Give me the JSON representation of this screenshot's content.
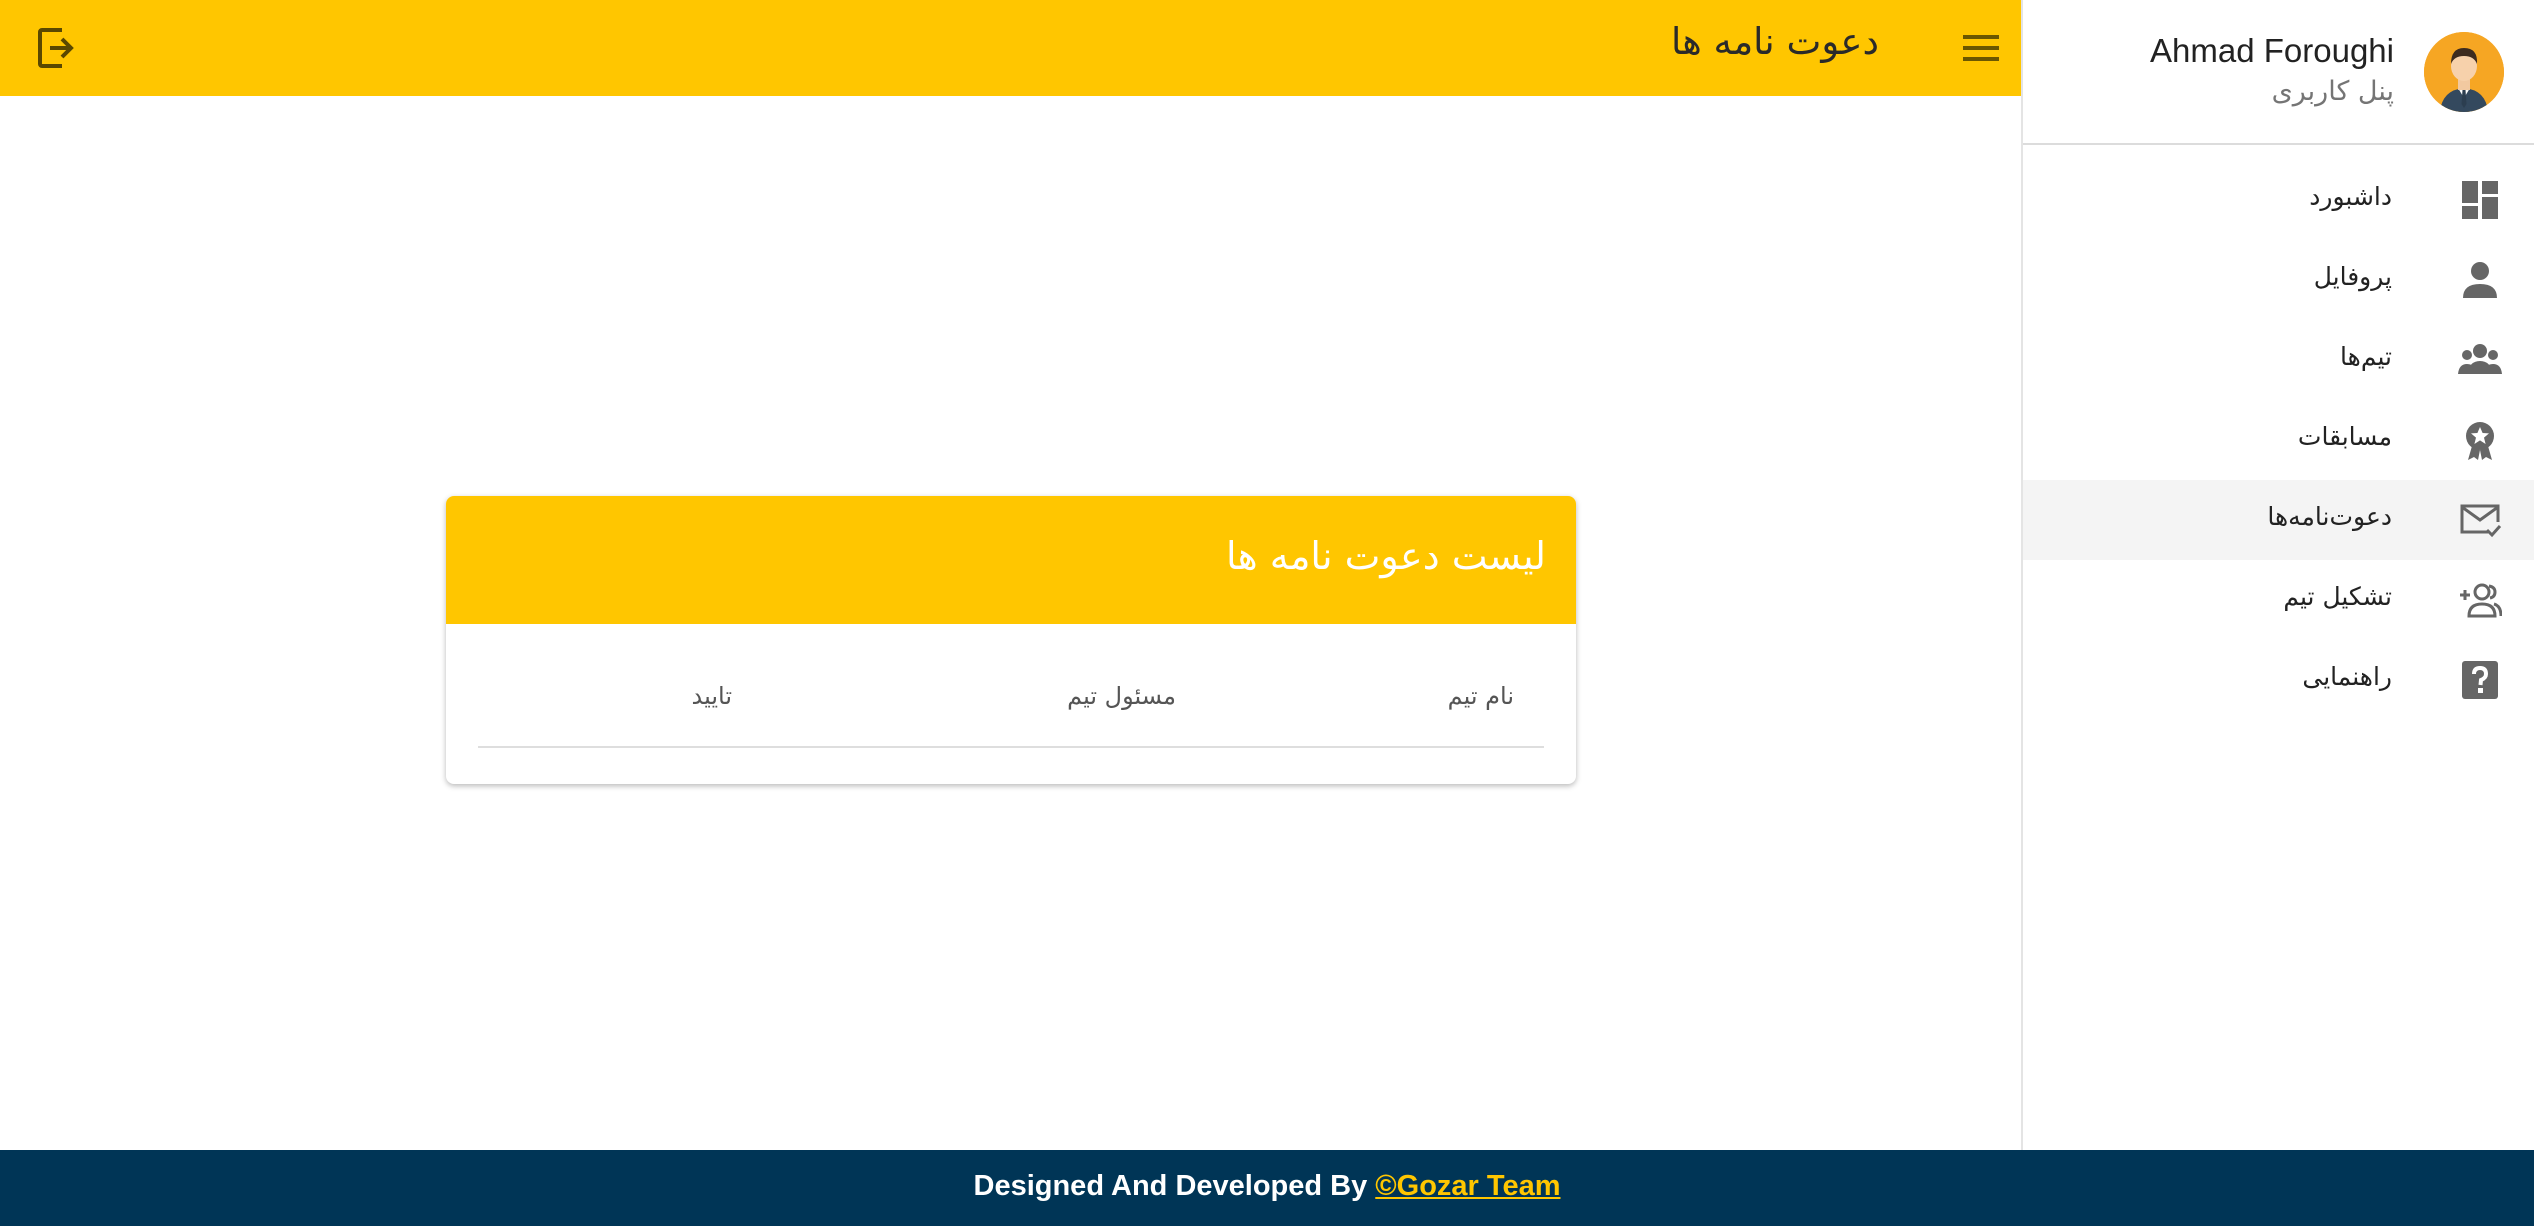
{
  "header": {
    "title": "دعوت نامه ها",
    "menu_icon": "hamburger-menu-icon",
    "logout_icon": "logout-icon"
  },
  "sidebar": {
    "user": {
      "name": "Ahmad Foroughi",
      "role": "پنل کاربری",
      "avatar_icon": "user-avatar-icon"
    },
    "items": [
      {
        "label": "داشبورد",
        "icon": "dashboard-icon",
        "active": false
      },
      {
        "label": "پروفایل",
        "icon": "person-icon",
        "active": false
      },
      {
        "label": "تیم‌ها",
        "icon": "group-icon",
        "active": false
      },
      {
        "label": "مسابقات",
        "icon": "award-icon",
        "active": false
      },
      {
        "label": "دعوت‌نامه‌ها",
        "icon": "mail-check-icon",
        "active": true
      },
      {
        "label": "تشکیل تیم",
        "icon": "group-add-icon",
        "active": false
      },
      {
        "label": "راهنمایی",
        "icon": "help-icon",
        "active": false
      }
    ]
  },
  "card": {
    "title": "لیست دعوت نامه ها",
    "columns": [
      "نام تیم",
      "مسئول تیم",
      "تایید"
    ],
    "rows": []
  },
  "footer": {
    "prefix": "Designed And Developed By ",
    "link": "©Gozar Team"
  },
  "colors": {
    "accent": "#ffc600",
    "footer_bg": "#003556",
    "active_item_bg": "#f4f4f4"
  }
}
